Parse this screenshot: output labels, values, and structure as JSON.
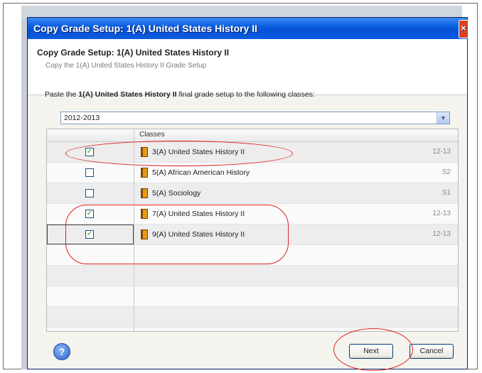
{
  "dialog": {
    "window_title": "Copy Grade Setup: 1(A) United States History II",
    "header_title": "Copy Grade Setup: 1(A) United States History II",
    "header_subtitle": "Copy the 1(A) United States History II Grade Setup",
    "instruction_prefix": "Paste the ",
    "instruction_course": "1(A) United States History II",
    "instruction_suffix": " final grade setup to the following classes:",
    "year_selected": "2012-2013",
    "close_glyph": "×"
  },
  "grid": {
    "column_header": "Classes",
    "rows": [
      {
        "checked": true,
        "name": "3(A) United States History II",
        "term": "12-13"
      },
      {
        "checked": false,
        "name": "5(A) African American History",
        "term": "S2"
      },
      {
        "checked": false,
        "name": "5(A) Sociology",
        "term": "S1"
      },
      {
        "checked": true,
        "name": "7(A) United States History II",
        "term": "12-13"
      },
      {
        "checked": true,
        "name": "9(A) United States History II",
        "term": "12-13"
      }
    ]
  },
  "footer": {
    "help_glyph": "?",
    "next_label": "Next",
    "cancel_label": "Cancel"
  },
  "icons": {
    "check_glyph": "✓",
    "dropdown_glyph": "▼"
  },
  "colors": {
    "annotation": "#e02020",
    "titlebar": "#0a5fe0"
  }
}
